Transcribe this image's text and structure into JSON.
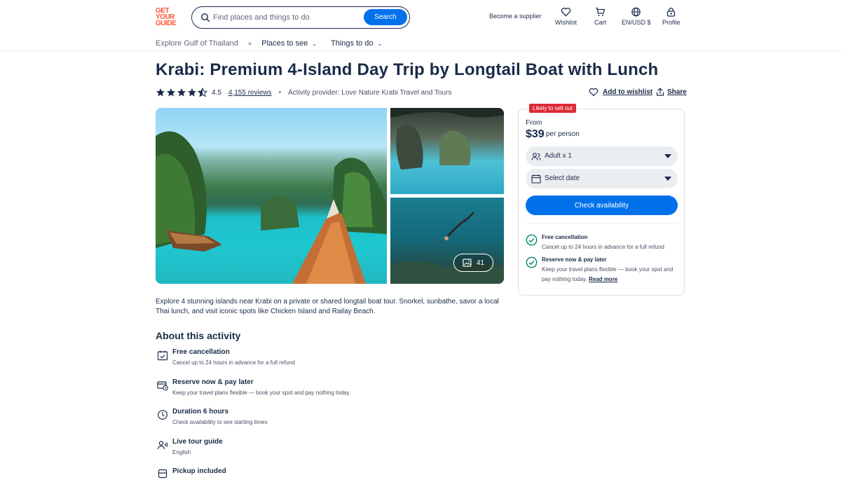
{
  "header": {
    "logo_lines": [
      "GET",
      "YOUR",
      "GUIDE"
    ],
    "search_placeholder": "Find places and things to do",
    "search_button": "Search",
    "become_supplier": "Become a supplier",
    "wishlist": "Wishlist",
    "cart": "Cart",
    "locale": "EN/USD $",
    "profile": "Profile"
  },
  "subnav": {
    "breadcrumb": "Explore Gulf of Thailand",
    "menus": [
      "Places to see",
      "Things to do"
    ]
  },
  "activity": {
    "title": "Krabi: Premium 4-Island Day Trip by Longtail Boat with Lunch",
    "rating": "4.5",
    "rating_value": 4.5,
    "reviews": "4,155 reviews",
    "provider": "Activity provider: Love Nature Krabi Travel and Tours",
    "add_to_wishlist": "Add to wishlist",
    "share": "Share",
    "photo_count": "41",
    "description": "Explore 4 stunning islands near Krabi on a private or shared longtail boat tour. Snorkel, sunbathe, savor a local Thai lunch, and visit iconic spots like Chicken Island and Railay Beach."
  },
  "about": {
    "heading": "About this activity",
    "features": [
      {
        "icon": "calendar-check-icon",
        "title": "Free cancellation",
        "sub": "Cancel up to 24 hours in advance for a full refund"
      },
      {
        "icon": "card-clock-icon",
        "title": "Reserve now & pay later",
        "sub": "Keep your travel plans flexible — book your spot and pay nothing today."
      },
      {
        "icon": "clock-icon",
        "title": "Duration 6 hours",
        "sub": "Check availability to see starting times"
      },
      {
        "icon": "guide-icon",
        "title": "Live tour guide",
        "sub": "English"
      },
      {
        "icon": "bus-icon",
        "title": "Pickup included",
        "sub": ""
      }
    ]
  },
  "booking": {
    "badge": "Likely to sell out",
    "from": "From",
    "price": "$39",
    "per": "per person",
    "participants": "Adult x 1",
    "date": "Select date",
    "check_button": "Check availability",
    "free_cancel_title": "Free cancellation",
    "free_cancel_sub": "Cancel up to 24 hours in advance for a full refund",
    "reserve_title": "Reserve now & pay later",
    "reserve_sub": "Keep your travel plans flexible — book your spot and pay nothing today.",
    "read_more": "Read more"
  },
  "colors": {
    "brand": "#ff5533",
    "primary": "#0071eb",
    "text": "#1a2b49",
    "badge": "#dc2a36",
    "success": "#008768"
  }
}
